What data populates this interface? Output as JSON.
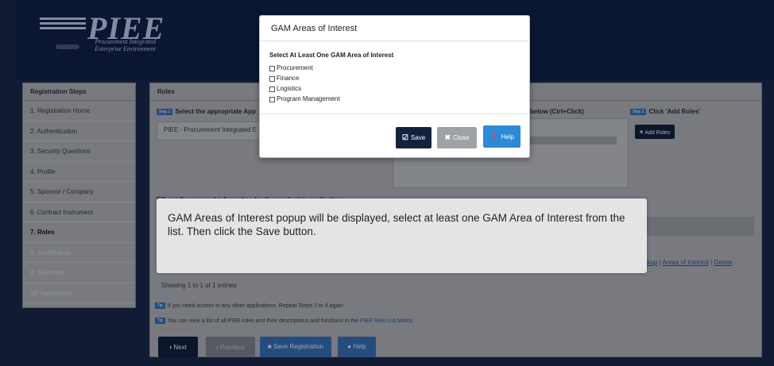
{
  "logo": {
    "title": "PIEE",
    "subtitle_line1": "Procurement Integrated",
    "subtitle_line2": "Enterprise Environment"
  },
  "sidebar": {
    "title": "Registration Steps",
    "items": [
      {
        "label": "1. Registration Home",
        "state": "normal"
      },
      {
        "label": "2. Authentication",
        "state": "normal"
      },
      {
        "label": "3. Security Questions",
        "state": "normal"
      },
      {
        "label": "4. Profile",
        "state": "normal"
      },
      {
        "label": "5. Sponsor / Company",
        "state": "normal"
      },
      {
        "label": "6. Contract Instrument",
        "state": "normal"
      },
      {
        "label": "7. Roles",
        "state": "active"
      },
      {
        "label": "8. Justification",
        "state": "disabled"
      },
      {
        "label": "9. Summary",
        "state": "disabled"
      },
      {
        "label": "10. Agreement",
        "state": "disabled"
      }
    ]
  },
  "main": {
    "header": "Roles",
    "step1_badge": "Step 1",
    "step1_label": "Select the appropriate App",
    "app_value": "PIEE - Procurement Integrated E",
    "step2_label": "below (Ctrl+Click)",
    "step3_badge": "Step 3",
    "step3_label": "Click 'Add Roles'",
    "add_roles": "Add Roles",
    "fill_label": "Fill out the required information for the applicable applications",
    "links": {
      "lookup": "Lookup",
      "areas": "Areas of Interest",
      "delete": "Delete"
    },
    "entries": "Showing 1 to 1 of 1 entries",
    "tip_badge": "Tip",
    "tip1": "If you need access to any other applications, Repeat Steps 1 to 4 again",
    "tip2_prefix": "You can view a list of all PIEE roles and their descriptions and functions in the ",
    "tip2_link": "PIEE Role List Matrix",
    "tip2_suffix": "."
  },
  "navbar": {
    "next": "Next",
    "previous": "Previous",
    "save_registration": "Save Registration",
    "help": "Help"
  },
  "modal": {
    "title": "GAM Areas of Interest",
    "prompt": "Select At Least One GAM Area of Interest",
    "options": [
      "Procurement",
      "Finance",
      "Logistics",
      "Program Management"
    ],
    "save": "Save",
    "close": "Close",
    "help": "Help"
  },
  "tooltip": "GAM Areas of Interest popup will be displayed, select at least one GAM Area of Interest from the list.  Then click the Save button."
}
